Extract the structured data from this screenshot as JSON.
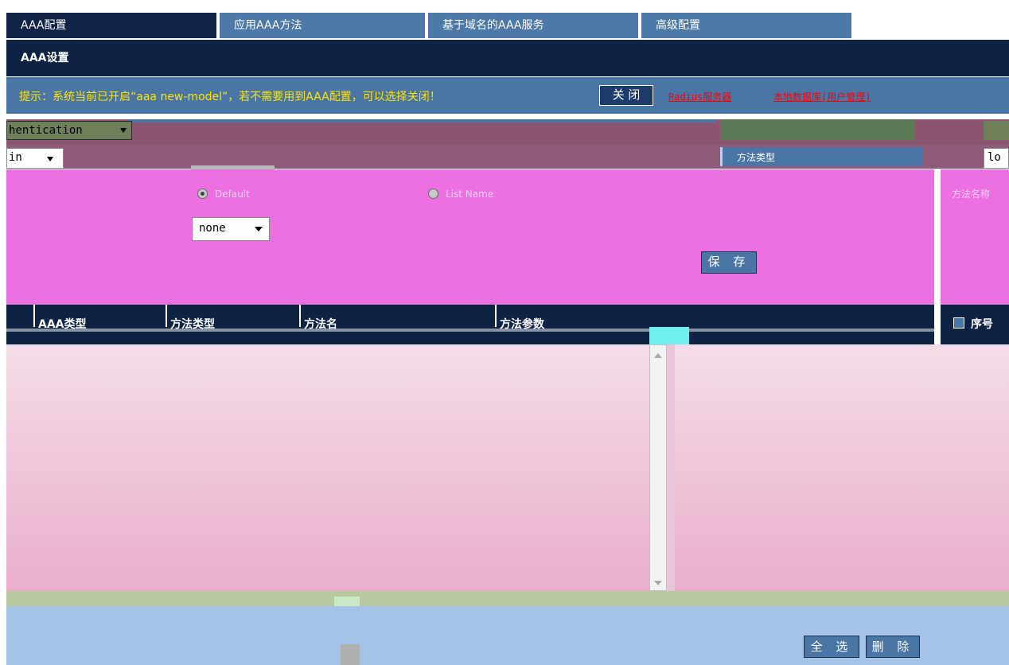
{
  "tabs": [
    {
      "label": "AAA配置",
      "active": true
    },
    {
      "label": "应用AAA方法",
      "active": false
    },
    {
      "label": "基于域名的AAA服务",
      "active": false
    },
    {
      "label": "高级配置",
      "active": false
    }
  ],
  "section_title": "AAA设置",
  "notice": {
    "text": "提示：系统当前已开启“aaa new-model”，若不需要用到AAA配置，可以选择关闭！",
    "close_label": "关 闭",
    "link_radius": "Radius服务器",
    "link_local_db": "本地数据库(用户管理)"
  },
  "form": {
    "type_select_value": "hentication",
    "login_select_value": "in",
    "method_label": "方法类型",
    "right_select_value": "lo",
    "right_field_label": "方法名称",
    "radio_default_label": "Default",
    "radio_list_label": "List Name",
    "method_select_value": "none",
    "save_label": "保 存"
  },
  "table": {
    "columns": [
      "AAA类型",
      "方法类型",
      "方法名",
      "方法参数"
    ],
    "right_column": "序号"
  },
  "buttons": {
    "select_all": "全 选",
    "delete": "删 除"
  },
  "colors": {
    "dark_navy": "#0e2244",
    "steel_blue": "#4a76a6",
    "notice_yellow": "#ffe400",
    "link_red": "#ff0000",
    "panel_pink": "#ed70e3"
  }
}
